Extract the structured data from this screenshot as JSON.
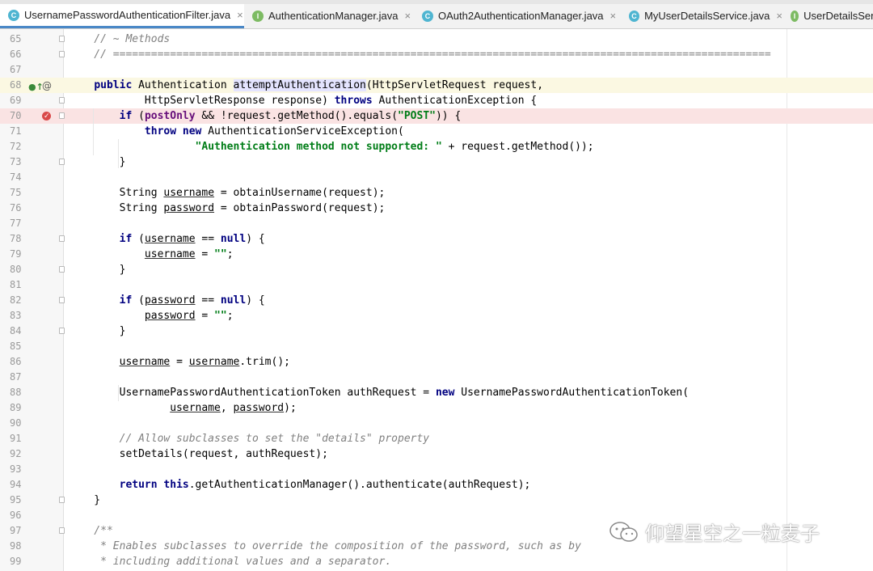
{
  "tabs": [
    {
      "label": "UsernamePasswordAuthenticationFilter.java",
      "kind": "C",
      "active": true
    },
    {
      "label": "AuthenticationManager.java",
      "kind": "I"
    },
    {
      "label": "OAuth2AuthenticationManager.java",
      "kind": "C"
    },
    {
      "label": "MyUserDetailsService.java",
      "kind": "C"
    },
    {
      "label": "UserDetailsServ",
      "kind": "I"
    }
  ],
  "tab_close_glyph": "×",
  "gutter_icons": {
    "override": "●↑",
    "annotation": "@"
  },
  "watermark": "仰望星空之一粒麦子",
  "colors": {
    "keyword": "#000080",
    "string": "#007d17",
    "comment": "#808080",
    "field": "#660e7a",
    "active_tab_underline": "#4a88c7",
    "breakpoint": "#d94a4a"
  },
  "lines": [
    {
      "n": "65",
      "segs": [
        {
          "t": "    // ~ Methods",
          "c": "cmt"
        }
      ]
    },
    {
      "n": "66",
      "segs": [
        {
          "t": "    // ========================================================================================================",
          "c": "cmt"
        }
      ]
    },
    {
      "n": "67",
      "segs": []
    },
    {
      "n": "68",
      "segs": [
        {
          "t": "    "
        },
        {
          "t": "public",
          "c": "kw"
        },
        {
          "t": " Authentication "
        },
        {
          "t": "attemptAuthentication",
          "c": "mdecl"
        },
        {
          "t": "(HttpServletRequest request,"
        }
      ]
    },
    {
      "n": "69",
      "segs": [
        {
          "t": "            HttpServletResponse response) "
        },
        {
          "t": "throws",
          "c": "kw"
        },
        {
          "t": " AuthenticationException {"
        }
      ]
    },
    {
      "n": "70",
      "segs": [
        {
          "t": "        "
        },
        {
          "t": "if",
          "c": "kw"
        },
        {
          "t": " ("
        },
        {
          "t": "postOnly",
          "c": "fld"
        },
        {
          "t": " && !request.getMethod().equals("
        },
        {
          "t": "\"POST\"",
          "c": "str"
        },
        {
          "t": ")) {"
        }
      ]
    },
    {
      "n": "71",
      "segs": [
        {
          "t": "            "
        },
        {
          "t": "throw",
          "c": "kw"
        },
        {
          "t": " "
        },
        {
          "t": "new",
          "c": "kw"
        },
        {
          "t": " AuthenticationServiceException("
        }
      ]
    },
    {
      "n": "72",
      "segs": [
        {
          "t": "                    "
        },
        {
          "t": "\"Authentication method not supported: \"",
          "c": "str"
        },
        {
          "t": " + request.getMethod());"
        }
      ]
    },
    {
      "n": "73",
      "segs": [
        {
          "t": "        }"
        }
      ]
    },
    {
      "n": "74",
      "segs": []
    },
    {
      "n": "75",
      "segs": [
        {
          "t": "        String "
        },
        {
          "t": "username",
          "c": "ul"
        },
        {
          "t": " = obtainUsername(request);"
        }
      ]
    },
    {
      "n": "76",
      "segs": [
        {
          "t": "        String "
        },
        {
          "t": "password",
          "c": "ul"
        },
        {
          "t": " = obtainPassword(request);"
        }
      ]
    },
    {
      "n": "77",
      "segs": []
    },
    {
      "n": "78",
      "segs": [
        {
          "t": "        "
        },
        {
          "t": "if",
          "c": "kw"
        },
        {
          "t": " ("
        },
        {
          "t": "username",
          "c": "ul"
        },
        {
          "t": " == "
        },
        {
          "t": "null",
          "c": "kw"
        },
        {
          "t": ") {"
        }
      ]
    },
    {
      "n": "79",
      "segs": [
        {
          "t": "            "
        },
        {
          "t": "username",
          "c": "ul"
        },
        {
          "t": " = "
        },
        {
          "t": "\"\"",
          "c": "str"
        },
        {
          "t": ";"
        }
      ]
    },
    {
      "n": "80",
      "segs": [
        {
          "t": "        }"
        }
      ]
    },
    {
      "n": "81",
      "segs": []
    },
    {
      "n": "82",
      "segs": [
        {
          "t": "        "
        },
        {
          "t": "if",
          "c": "kw"
        },
        {
          "t": " ("
        },
        {
          "t": "password",
          "c": "ul"
        },
        {
          "t": " == "
        },
        {
          "t": "null",
          "c": "kw"
        },
        {
          "t": ") {"
        }
      ]
    },
    {
      "n": "83",
      "segs": [
        {
          "t": "            "
        },
        {
          "t": "password",
          "c": "ul"
        },
        {
          "t": " = "
        },
        {
          "t": "\"\"",
          "c": "str"
        },
        {
          "t": ";"
        }
      ]
    },
    {
      "n": "84",
      "segs": [
        {
          "t": "        }"
        }
      ]
    },
    {
      "n": "85",
      "segs": []
    },
    {
      "n": "86",
      "segs": [
        {
          "t": "        "
        },
        {
          "t": "username",
          "c": "ul"
        },
        {
          "t": " = "
        },
        {
          "t": "username",
          "c": "ul"
        },
        {
          "t": ".trim();"
        }
      ]
    },
    {
      "n": "87",
      "segs": []
    },
    {
      "n": "88",
      "segs": [
        {
          "t": "        UsernamePasswordAuthenticationToken authRequest = "
        },
        {
          "t": "new",
          "c": "kw"
        },
        {
          "t": " UsernamePasswordAuthenticationToken("
        }
      ]
    },
    {
      "n": "89",
      "segs": [
        {
          "t": "                "
        },
        {
          "t": "username",
          "c": "ul"
        },
        {
          "t": ", "
        },
        {
          "t": "password",
          "c": "ul"
        },
        {
          "t": ");"
        }
      ]
    },
    {
      "n": "90",
      "segs": []
    },
    {
      "n": "91",
      "segs": [
        {
          "t": "        // Allow subclasses to set the \"details\" property",
          "c": "cmt"
        }
      ]
    },
    {
      "n": "92",
      "segs": [
        {
          "t": "        setDetails(request, authRequest);"
        }
      ]
    },
    {
      "n": "93",
      "segs": []
    },
    {
      "n": "94",
      "segs": [
        {
          "t": "        "
        },
        {
          "t": "return",
          "c": "kw"
        },
        {
          "t": " "
        },
        {
          "t": "this",
          "c": "kw"
        },
        {
          "t": ".getAuthenticationManager().authenticate(authRequest);"
        }
      ]
    },
    {
      "n": "95",
      "segs": [
        {
          "t": "    }"
        }
      ]
    },
    {
      "n": "96",
      "segs": []
    },
    {
      "n": "97",
      "segs": [
        {
          "t": "    /**",
          "c": "cmt"
        }
      ]
    },
    {
      "n": "98",
      "segs": [
        {
          "t": "     * Enables subclasses to override the composition of the password, such as by",
          "c": "cmt"
        }
      ]
    },
    {
      "n": "99",
      "segs": [
        {
          "t": "     * including additional values and a separator.",
          "c": "cmt"
        }
      ]
    }
  ]
}
